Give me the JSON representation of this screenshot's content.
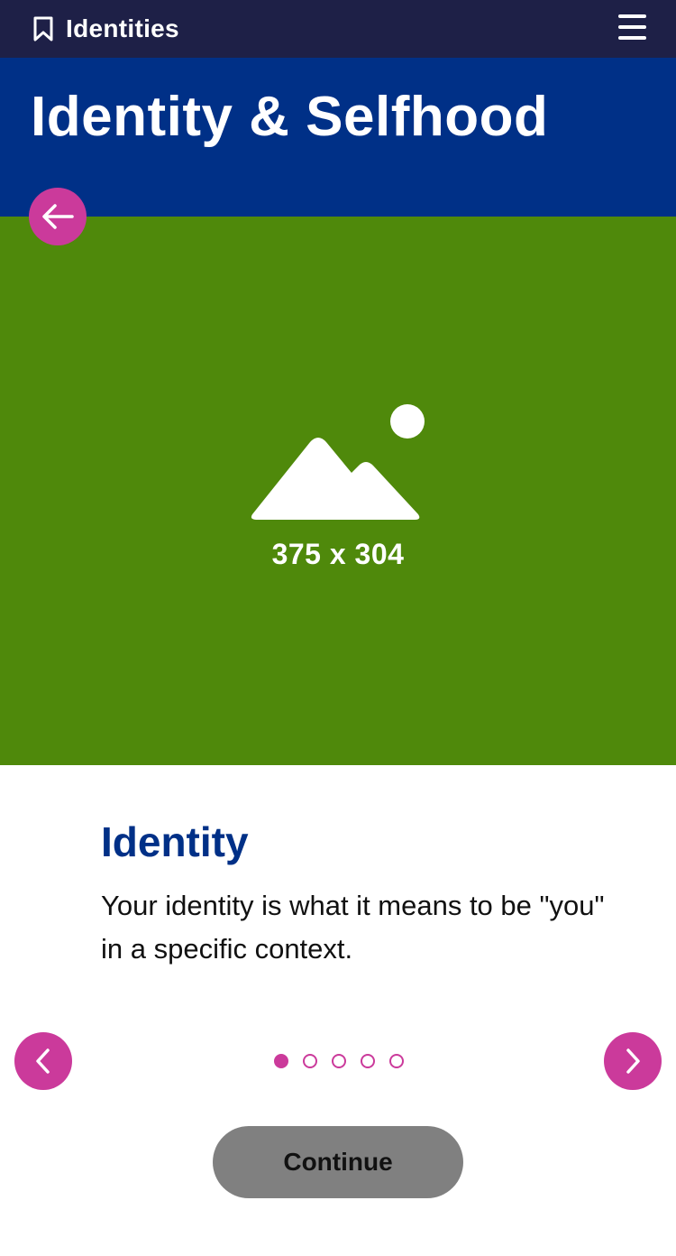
{
  "topbar": {
    "brand": "Identities",
    "bookmark_icon": "bookmark-icon",
    "menu_icon": "hamburger-menu-icon"
  },
  "header": {
    "title": "Identity & Selfhood"
  },
  "hero": {
    "image_icon": "image-placeholder-icon",
    "dimensions_label": "375 x 304"
  },
  "slide": {
    "title": "Identity",
    "body": "Your identity is what it means to be \"you\" in a specific context."
  },
  "pager": {
    "total": 5,
    "current": 1
  },
  "buttons": {
    "continue_label": "Continue"
  },
  "colors": {
    "topbar": "#1e2047",
    "header": "#003087",
    "hero": "#4f890b",
    "accent": "#cb3a9b",
    "continue_bg": "#808080"
  }
}
